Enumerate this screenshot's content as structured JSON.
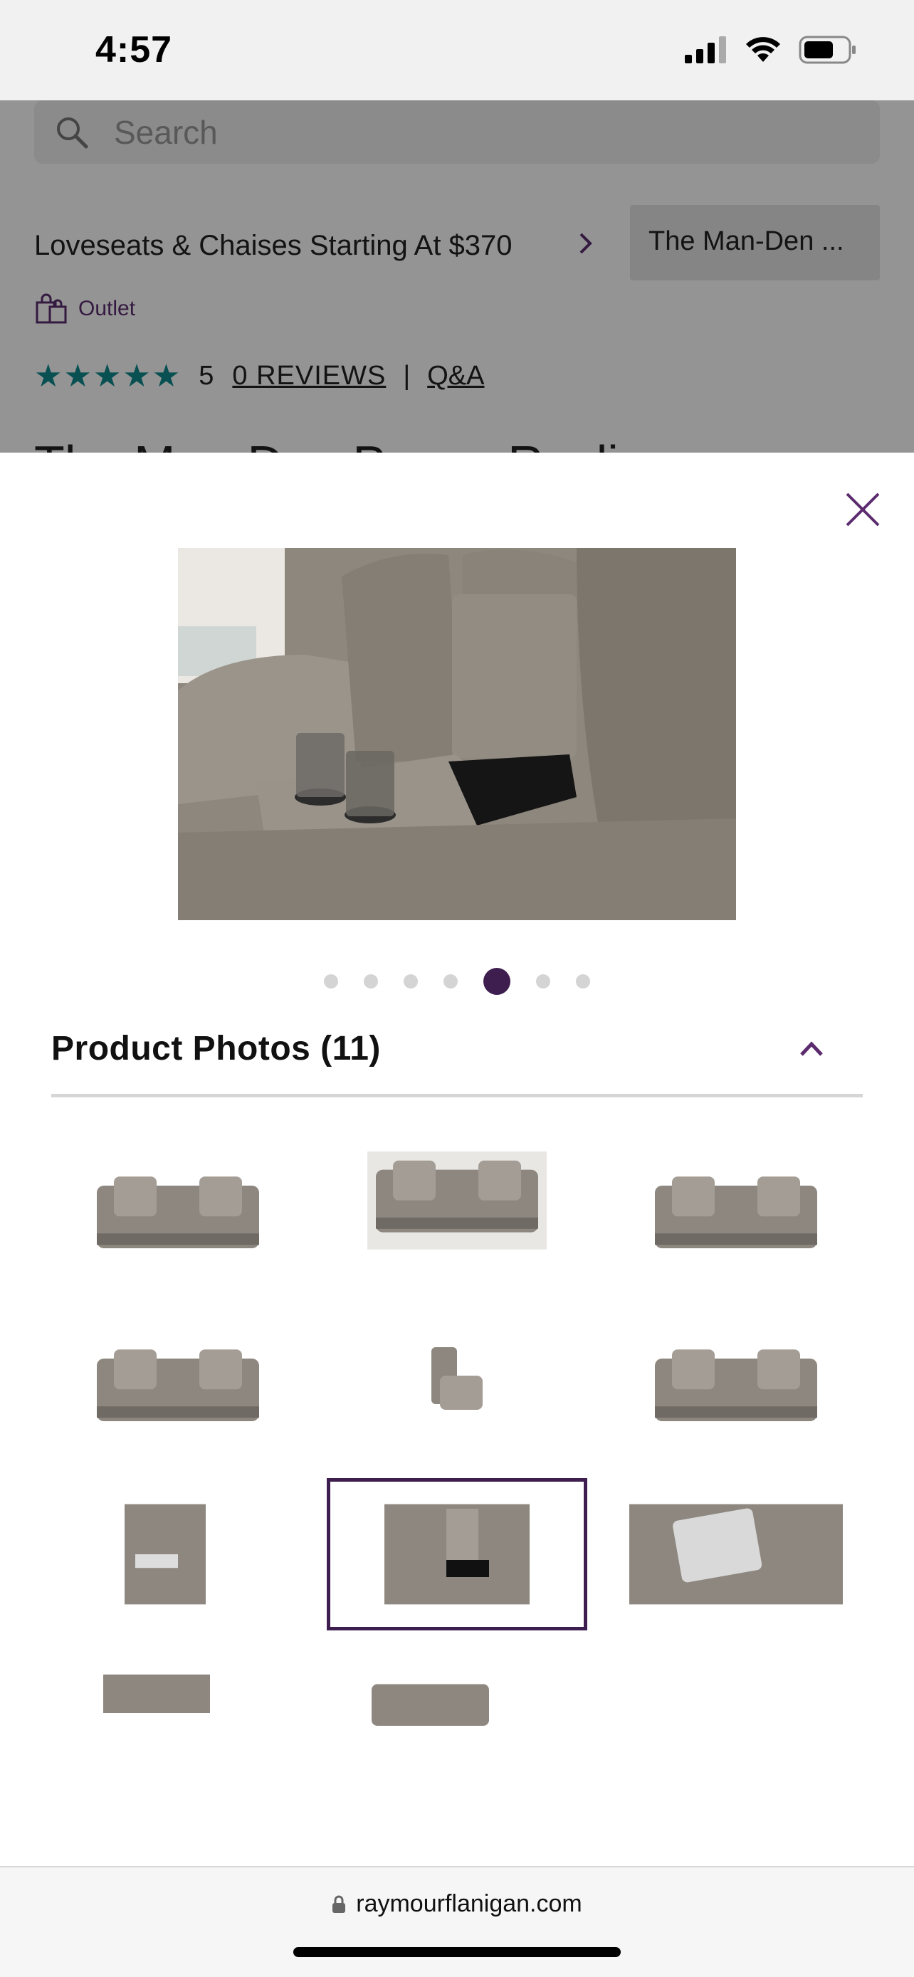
{
  "status_bar": {
    "time": "4:57"
  },
  "background_page": {
    "search_placeholder": "Search",
    "promo_link": "Loveseats & Chaises Starting At $370",
    "man_den_pill": "The Man-Den ...",
    "outlet_label": "Outlet",
    "rating_value": "5",
    "reviews_link": "0 REVIEWS",
    "separator": "|",
    "qa_link": "Q&A",
    "title_peek": "The Man-Den Power Recliner"
  },
  "modal": {
    "carousel": {
      "total_dots": 7,
      "active_index": 4
    },
    "section_title": "Product Photos (11)",
    "thumbnails": [
      {
        "name": "front-view",
        "selected": false
      },
      {
        "name": "room-front-view",
        "selected": false
      },
      {
        "name": "angle-view",
        "selected": false
      },
      {
        "name": "reclined-view",
        "selected": false
      },
      {
        "name": "side-view",
        "selected": false
      },
      {
        "name": "back-view",
        "selected": false
      },
      {
        "name": "storage-arm-view",
        "selected": false
      },
      {
        "name": "console-cupholder-view",
        "selected": true
      },
      {
        "name": "power-control-view",
        "selected": false
      },
      {
        "name": "fabric-swatch-view",
        "selected": false
      },
      {
        "name": "dimensions-view",
        "selected": false
      }
    ]
  },
  "url_bar": {
    "domain": "raymourflanigan.com"
  },
  "colors": {
    "accent": "#3e1e4f",
    "outlet": "#5b2b6e",
    "stars": "#0f8a8e"
  }
}
